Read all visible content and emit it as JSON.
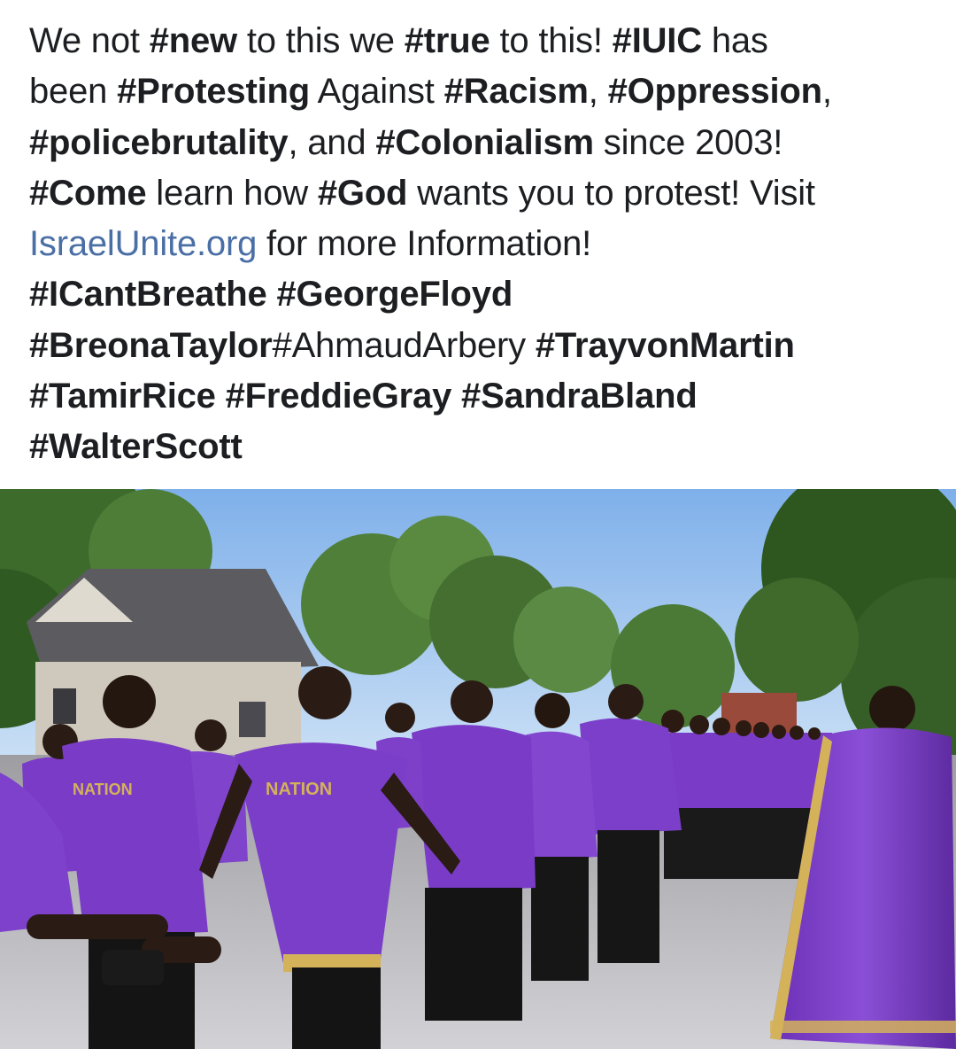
{
  "post": {
    "text": {
      "l1_a": "We not ",
      "l1_b": "#new",
      "l1_c": " to this we ",
      "l1_d": "#true",
      "l1_e": " to this! ",
      "l1_f": "#IUIC",
      "l1_g": " has",
      "l2_a": "been ",
      "l2_b": "#Protesting",
      "l2_c": " Against ",
      "l2_d": "#Racism",
      "l2_e": ", ",
      "l2_f": "#Oppression",
      "l2_g": ",",
      "l3_a": "#policebrutality",
      "l3_b": ", and ",
      "l3_c": "#Colonialism",
      "l3_d": " since 2003!",
      "l4_a": "#Come",
      "l4_b": " learn how ",
      "l4_c": "#God",
      "l4_d": " wants you to protest! Visit",
      "l5_link": "IsraelUnite.org",
      "l5_b": " for more Information!",
      "l6_a": "#ICantBreathe",
      "l6_b": " ",
      "l6_c": "#GeorgeFloyd",
      "l7_a": "#BreonaTaylor",
      "l7_b": "#AhmaudArbery ",
      "l7_c": "#TrayvonMartin",
      "l8_a": "#TamirRice",
      "l8_b": " ",
      "l8_c": "#FreddieGray",
      "l8_d": " ",
      "l8_e": "#SandraBland",
      "l9_a": "#WalterScott"
    },
    "photo": {
      "shirt_text_1": "NATION",
      "shirt_text_2": "NATION"
    }
  },
  "colors": {
    "text": "#1c1e21",
    "link": "#4a6fa5",
    "shirt_purple": "#7a3cc6",
    "gold": "#d4b25a",
    "sky": "#8fb8ea"
  }
}
